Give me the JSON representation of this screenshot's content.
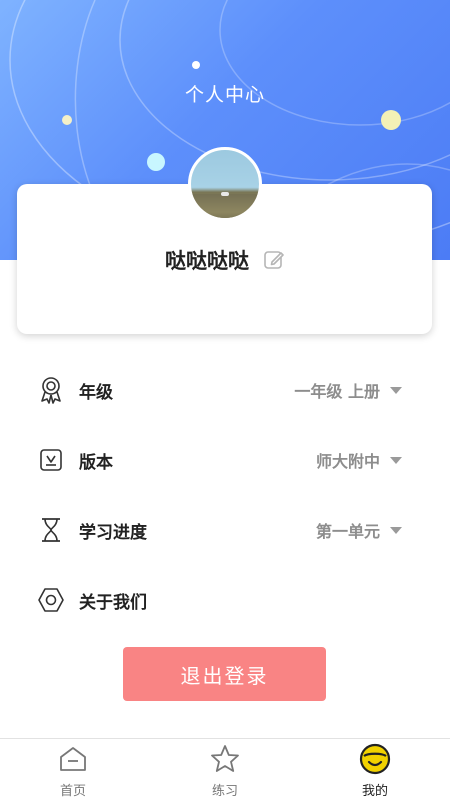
{
  "header": {
    "title": "个人中心",
    "gradient_start": "#7fb3ff",
    "gradient_end": "#4c7cf5"
  },
  "profile": {
    "avatar_icon": "avatar-photo",
    "user_name": "哒哒哒哒",
    "edit_icon": "edit-icon"
  },
  "menu": {
    "items": [
      {
        "icon": "award-ribbon-icon",
        "label": "年级",
        "value": "一年级 上册",
        "has_dropdown": true
      },
      {
        "icon": "book-edition-icon",
        "label": "版本",
        "value": "师大附中",
        "has_dropdown": true
      },
      {
        "icon": "hourglass-icon",
        "label": "学习进度",
        "value": "第一单元",
        "has_dropdown": true
      },
      {
        "icon": "hexagon-nut-icon",
        "label": "关于我们",
        "value": "",
        "has_dropdown": false
      }
    ]
  },
  "logout": {
    "label": "退出登录",
    "color": "#f98484"
  },
  "tabbar": {
    "tabs": [
      {
        "icon": "home-icon",
        "label": "首页",
        "active": false
      },
      {
        "icon": "star-icon",
        "label": "练习",
        "active": false
      },
      {
        "icon": "smiley-icon",
        "label": "我的",
        "active": true
      }
    ]
  }
}
